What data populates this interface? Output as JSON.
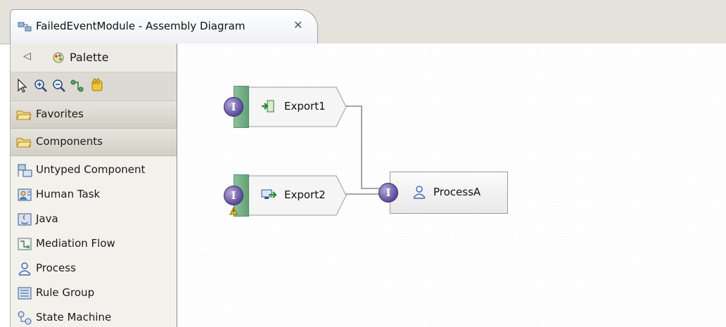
{
  "window": {
    "tab_title": "FailedEventModule - Assembly Diagram",
    "tab_close": "✕",
    "tab_icon": "assembly-diagram-icon"
  },
  "palette": {
    "title": "Palette",
    "collapse_glyph": "◁",
    "tools": [
      "select-arrow-icon",
      "zoom-in-icon",
      "zoom-out-icon",
      "wire-icon",
      "hand-icon"
    ],
    "drawers": [
      {
        "label": "Favorites",
        "icon": "folder-open-icon"
      },
      {
        "label": "Components",
        "icon": "folder-open-icon"
      }
    ],
    "items": [
      {
        "label": "Untyped Component",
        "icon": "untyped-component-icon"
      },
      {
        "label": "Human Task",
        "icon": "human-task-icon"
      },
      {
        "label": "Java",
        "icon": "java-icon"
      },
      {
        "label": "Mediation Flow",
        "icon": "mediation-flow-icon"
      },
      {
        "label": "Process",
        "icon": "process-icon"
      },
      {
        "label": "Rule Group",
        "icon": "rule-group-icon"
      },
      {
        "label": "State Machine",
        "icon": "state-machine-icon"
      }
    ]
  },
  "diagram": {
    "nodes": [
      {
        "label": "Export1",
        "type": "export",
        "icon": "export-arrow-icon",
        "interface_glyph": "I"
      },
      {
        "label": "Export2",
        "type": "export",
        "icon": "web-service-export-icon",
        "interface_glyph": "I",
        "warning": true
      },
      {
        "label": "ProcessA",
        "type": "component",
        "icon": "process-icon",
        "interface_glyph": "I"
      }
    ],
    "wires": [
      {
        "from": "Export1",
        "to": "ProcessA"
      },
      {
        "from": "Export2",
        "to": "ProcessA"
      }
    ]
  }
}
